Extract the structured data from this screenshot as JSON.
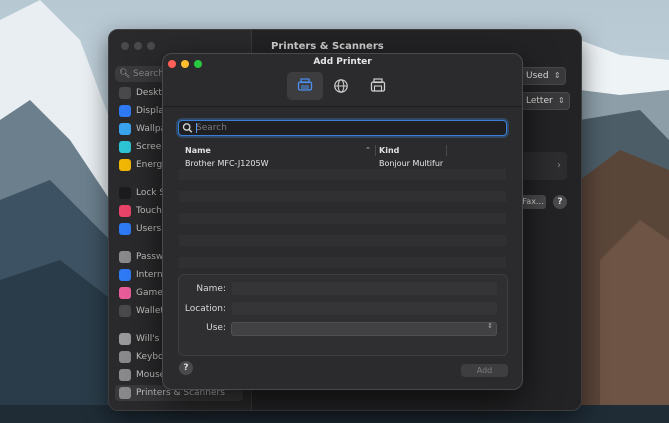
{
  "settings": {
    "search_placeholder": "Search",
    "title": "Printers & Scanners",
    "default_paper_popup": "Used",
    "paper_size_popup": "Letter",
    "fax_button": "Fax...",
    "help": "?",
    "sidebar_items": [
      {
        "label": "Desktop & Dock",
        "color": "#4a4a4c"
      },
      {
        "label": "Displays",
        "color": "#2f7bf6"
      },
      {
        "label": "Wallpaper",
        "color": "#3aa4f0"
      },
      {
        "label": "Screen Saver",
        "color": "#2ec4d6"
      },
      {
        "label": "Energy",
        "color": "#f2b705"
      },
      {
        "label": "Lock Screen",
        "color": "#1c1c1e"
      },
      {
        "label": "Touch ID & Password",
        "color": "#e9446a"
      },
      {
        "label": "Users & Groups",
        "color": "#2f7bf6"
      },
      {
        "label": "Passwords",
        "color": "#8a8a8c"
      },
      {
        "label": "Internet Accounts",
        "color": "#2f7bf6"
      },
      {
        "label": "Game Center",
        "color": "#e85d9a"
      },
      {
        "label": "Wallet & Apple Pay",
        "color": "#4a4a4c"
      },
      {
        "label": "Will's AirPods",
        "color": "#9a9a9c"
      },
      {
        "label": "Keyboard",
        "color": "#8a8a8c"
      },
      {
        "label": "Mouse",
        "color": "#8a8a8c"
      },
      {
        "label": "Printers & Scanners",
        "color": "#8a8a8c"
      }
    ]
  },
  "dialog": {
    "title": "Add Printer",
    "toolbar": [
      "default-printer-icon",
      "ip-globe-icon",
      "windows-printer-icon"
    ],
    "search_placeholder": "Search",
    "columns": {
      "name": "Name",
      "kind": "Kind"
    },
    "rows": [
      {
        "name": "Brother MFC-J1205W",
        "kind": "Bonjour Multifunct"
      }
    ],
    "form": {
      "name_label": "Name:",
      "location_label": "Location:",
      "use_label": "Use:"
    },
    "help": "?",
    "add_button": "Add"
  },
  "colors": {
    "close": "#ff5f57",
    "minimize": "#febc2e",
    "zoom": "#28c840",
    "focus": "#3a7fd5"
  }
}
